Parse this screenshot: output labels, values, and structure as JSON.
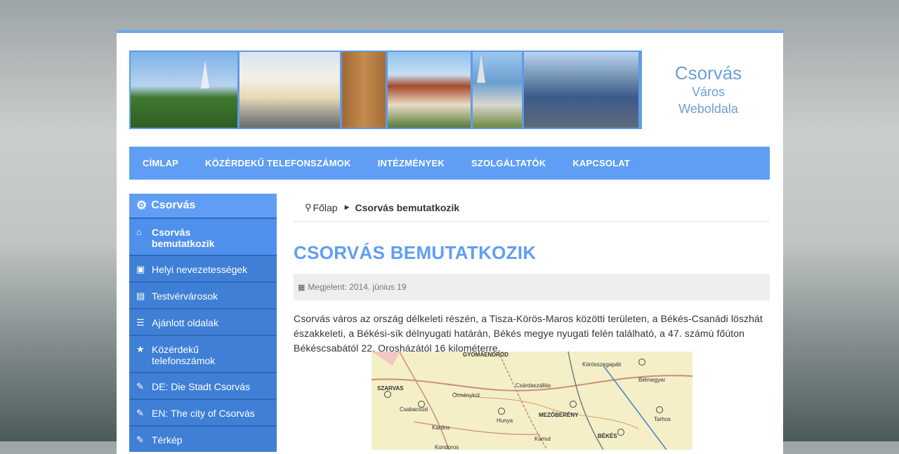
{
  "header": {
    "title_line1": "Csorvás",
    "title_line2": "Város",
    "title_line3": "Weboldala"
  },
  "nav": {
    "items": [
      {
        "label": "CÍMLAP"
      },
      {
        "label": "KÖZÉRDEKŰ TELEFONSZÁMOK"
      },
      {
        "label": "INTÉZMÉNYEK"
      },
      {
        "label": "SZOLGÁLTATÓK"
      },
      {
        "label": "KAPCSOLAT"
      }
    ]
  },
  "sidebar": {
    "heading": "Csorvás",
    "heading_icon": "gear-icon",
    "items": [
      {
        "label": "Csorvás bemutatkozik",
        "icon": "home-icon"
      },
      {
        "label": "Helyi nevezetességek",
        "icon": "camera-icon"
      },
      {
        "label": "Testvérvárosok",
        "icon": "shopping-bag-icon"
      },
      {
        "label": "Ajánlott oldalak",
        "icon": "list-icon"
      },
      {
        "label": "Közérdekű telefonszámok",
        "icon": "star-icon"
      },
      {
        "label": "DE: Die Stadt Csorvás",
        "icon": "pencil-icon"
      },
      {
        "label": "EN: The city of Csorvás",
        "icon": "pencil-icon"
      },
      {
        "label": "Térkép",
        "icon": "pencil-icon"
      }
    ]
  },
  "breadcrumb": {
    "home": "Főlap",
    "current": "Csorvás bemutatkozik"
  },
  "article": {
    "title": "CSORVÁS BEMUTATKOZIK",
    "meta": "Megjelent: 2014. június 19",
    "paragraph": "Csorvás város az ország délkeleti részén, a Tisza-Körös-Maros közötti területen, a Békés-Csanádi löszhát északkeleti, a Békési-sík délnyugati határán, Békés megye nyugati felén található, a 47. számú főúton Békéscsabától 22, Orosházától 16 kilométerre."
  },
  "map": {
    "labels": [
      "GYOMAENDRŐD",
      "Körösszegapáti",
      "SZARVAS",
      "Örménykút",
      "Csárdaszállás",
      "Bélmegyer",
      "Csabacsüd",
      "Hunya",
      "MEZŐBERÉNY",
      "Tarhos",
      "Kardos",
      "Kamut",
      "BÉKÉS",
      "Kondoros"
    ]
  }
}
